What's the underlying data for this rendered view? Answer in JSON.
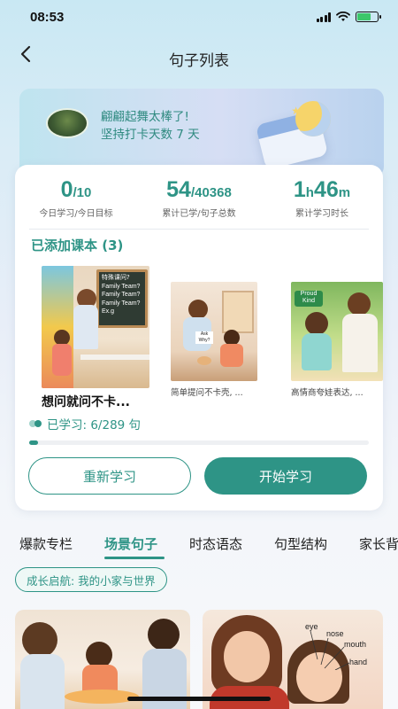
{
  "status_bar": {
    "time": "08:53"
  },
  "nav": {
    "title": "句子列表"
  },
  "banner": {
    "line1": "翩翩起舞太棒了!",
    "line2": "坚持打卡天数 7 天"
  },
  "stats": [
    {
      "value": "0",
      "unit": "/10",
      "label": "今日学习/今日目标"
    },
    {
      "value": "54",
      "unit": "/40368",
      "label": "累计已学/句子总数"
    },
    {
      "value": "1",
      "unit_h": "h",
      "value2": "46",
      "unit_m": "m",
      "label": "累计学习时长"
    }
  ],
  "added_books": {
    "title": "已添加课本 (3)",
    "items": [
      {
        "caption": "想问就问不卡...",
        "board_title": "特殊课问?",
        "board_lines": [
          "Family Team?",
          "Family Team?",
          "Family Team?",
          "Ex.g"
        ]
      },
      {
        "caption": "简单提问不卡壳, ...",
        "sign": "Ask Why?"
      },
      {
        "caption": "高情商夸娃表达, ...",
        "badge": "Proud Kind"
      }
    ]
  },
  "progress": {
    "text": "已学习: 6/289 句",
    "learned": 6,
    "total": 289
  },
  "buttons": {
    "restart": "重新学习",
    "start": "开始学习"
  },
  "tabs": [
    "爆款专栏",
    "场景句子",
    "时态语态",
    "句型结构",
    "家长背"
  ],
  "active_tab": 1,
  "chip": "成长启航: 我的小家与世界",
  "tile_labels": [
    "eye",
    "nose",
    "mouth",
    "hand"
  ],
  "colors": {
    "accent": "#2e9486",
    "banner_text": "#2f8a80"
  }
}
